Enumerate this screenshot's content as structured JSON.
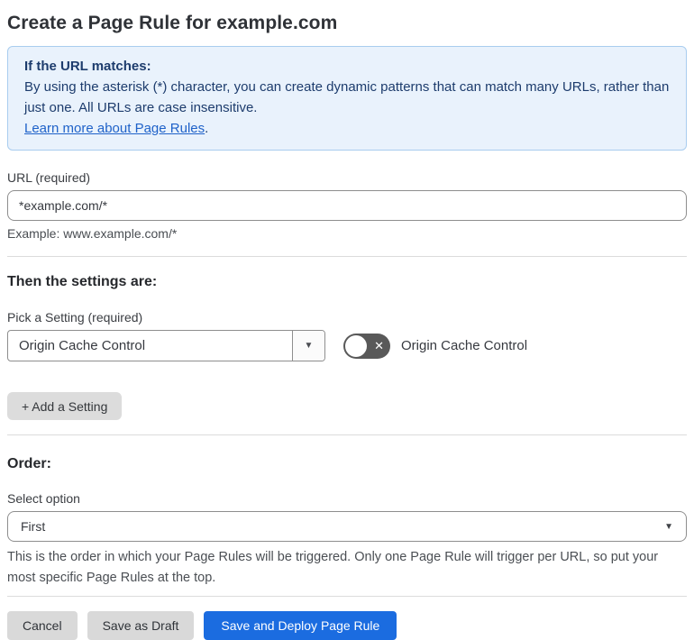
{
  "page": {
    "title": "Create a Page Rule for example.com"
  },
  "info_box": {
    "heading": "If the URL matches:",
    "body": "By using the asterisk (*) character, you can create dynamic patterns that can match many URLs, rather than just one. All URLs are case insensitive.",
    "link": "Learn more about Page Rules",
    "link_suffix": "."
  },
  "url_field": {
    "label": "URL (required)",
    "value": "*example.com/*",
    "example": "Example: www.example.com/*"
  },
  "settings_section": {
    "heading": "Then the settings are:",
    "picker_label": "Pick a Setting (required)",
    "selected_setting": "Origin Cache Control",
    "toggle_state": "off",
    "toggle_label": "Origin Cache Control",
    "add_setting_button": "+ Add a Setting"
  },
  "order_section": {
    "heading": "Order:",
    "select_label": "Select option",
    "selected_option": "First",
    "help_text": "This is the order in which your Page Rules will be triggered. Only one Page Rule will trigger per URL, so put your most specific Page Rules at the top."
  },
  "footer": {
    "cancel_button": "Cancel",
    "save_draft_button": "Save as Draft",
    "save_deploy_button": "Save and Deploy Page Rule"
  },
  "icons": {
    "toggle_off_x": "✕",
    "dropdown_arrow": "▼"
  },
  "colors": {
    "info_bg": "#e9f2fc",
    "info_border": "#a9cdef",
    "info_text": "#1d3c6d",
    "link": "#1f62c9",
    "primary_button_bg": "#1b6ce0",
    "secondary_button_bg": "#d9d9d9",
    "toggle_off_bg": "#595959",
    "input_border": "#8e8e8e",
    "divider": "#dcdcdc"
  }
}
